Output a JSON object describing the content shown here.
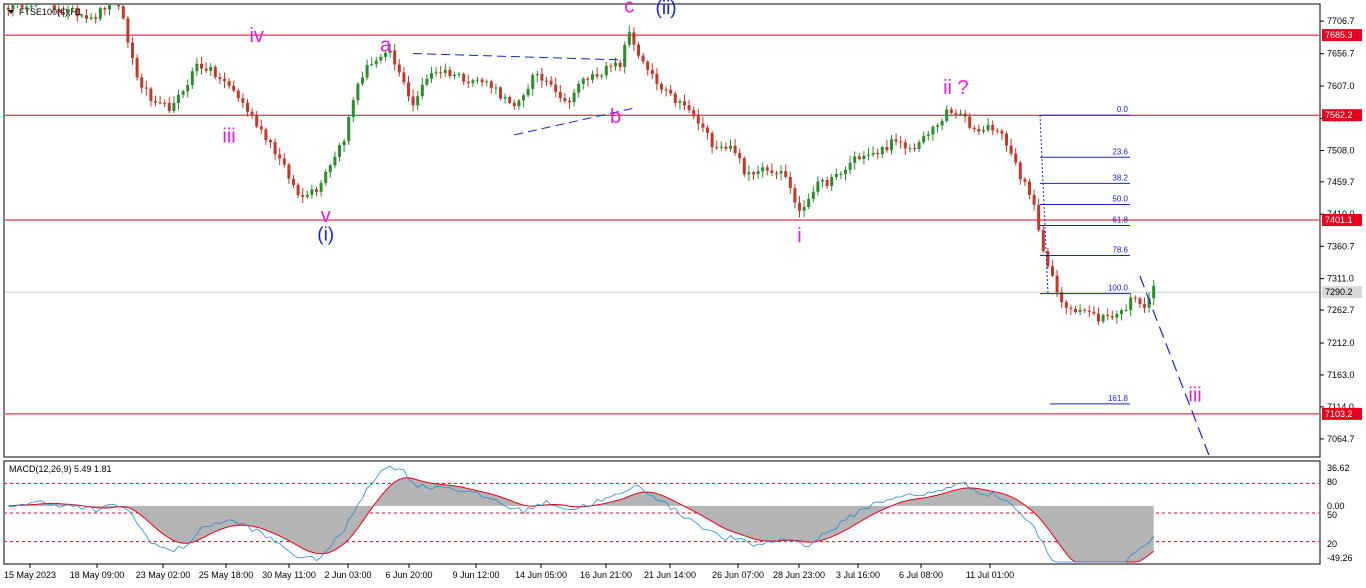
{
  "colors": {
    "bull": "#2e8b2e",
    "bear": "#c0392b",
    "hline": "#e8001c",
    "current_line": "#c8c8c8",
    "wave_major": "#1a23c8",
    "wave_minor": "#e020e0",
    "fib": "#1a23c8",
    "trend": "#1a23c8",
    "macd_hist": "#b4b4b4",
    "macd_signal": "#e8001c",
    "macd_line": "#2a8ad4"
  },
  "symbol_label": "FTSE100(€),H1",
  "chart_data": [
    {
      "type": "candlestick",
      "symbol": "FTSE100(€)",
      "timeframe": "H1",
      "ylim": [
        7040,
        7730
      ],
      "y_ticks": [
        "7706.7",
        "7656.7",
        "7607.0",
        "7557.0",
        "7508.0",
        "7459.7",
        "7410.0",
        "7360.7",
        "7311.0",
        "7262.7",
        "7212.0",
        "7163.0",
        "7114.0",
        "7064.7"
      ],
      "x_ticks": [
        "15 May 2023",
        "18 May 09:00",
        "23 May 02:00",
        "25 May 18:00",
        "30 May 11:00",
        "2 Jun 03:00",
        "6 Jun 20:00",
        "9 Jun 12:00",
        "14 Jun 05:00",
        "16 Jun 21:00",
        "21 Jun 14:00",
        "26 Jun 07:00",
        "28 Jun 23:00",
        "3 Jul 16:00",
        "6 Jul 08:00",
        "11 Jul 01:00"
      ],
      "horizontal_levels": [
        {
          "value": 7685.3,
          "label": "7685.3"
        },
        {
          "value": 7562.2,
          "label": "7562.2"
        },
        {
          "value": 7401.1,
          "label": "7401.1"
        },
        {
          "value": 7103.2,
          "label": "7103.2"
        }
      ],
      "current_price": {
        "value": 7290.2,
        "label": "7290.2"
      },
      "price_path_anchors": [
        [
          0,
          7730
        ],
        [
          6,
          7738
        ],
        [
          12,
          7722
        ],
        [
          19,
          7715
        ],
        [
          23,
          7742
        ],
        [
          25,
          7705
        ],
        [
          28,
          7620
        ],
        [
          32,
          7575
        ],
        [
          36,
          7575
        ],
        [
          41,
          7640
        ],
        [
          43,
          7635
        ],
        [
          49,
          7600
        ],
        [
          57,
          7520
        ],
        [
          63,
          7440
        ],
        [
          67,
          7450
        ],
        [
          73,
          7528
        ],
        [
          76,
          7612
        ],
        [
          79,
          7645
        ],
        [
          83,
          7655
        ],
        [
          86,
          7610
        ],
        [
          88,
          7580
        ],
        [
          92,
          7630
        ],
        [
          95,
          7630
        ],
        [
          99,
          7620
        ],
        [
          105,
          7610
        ],
        [
          110,
          7570
        ],
        [
          114,
          7620
        ],
        [
          118,
          7615
        ],
        [
          121,
          7580
        ],
        [
          125,
          7615
        ],
        [
          129,
          7630
        ],
        [
          133,
          7640
        ],
        [
          135,
          7690
        ],
        [
          138,
          7640
        ],
        [
          142,
          7600
        ],
        [
          148,
          7570
        ],
        [
          153,
          7520
        ],
        [
          158,
          7510
        ],
        [
          160,
          7470
        ],
        [
          164,
          7485
        ],
        [
          169,
          7470
        ],
        [
          172,
          7410
        ],
        [
          175,
          7450
        ],
        [
          181,
          7470
        ],
        [
          184,
          7498
        ],
        [
          188,
          7500
        ],
        [
          192,
          7520
        ],
        [
          196,
          7510
        ],
        [
          199,
          7525
        ],
        [
          204,
          7565
        ],
        [
          207,
          7562
        ],
        [
          210,
          7540
        ],
        [
          214,
          7545
        ],
        [
          217,
          7520
        ],
        [
          220,
          7470
        ],
        [
          223,
          7420
        ],
        [
          226,
          7330
        ],
        [
          229,
          7270
        ],
        [
          233,
          7265
        ],
        [
          237,
          7250
        ],
        [
          242,
          7260
        ],
        [
          245,
          7285
        ],
        [
          247,
          7270
        ],
        [
          249,
          7295
        ]
      ],
      "fibonacci": {
        "levels": [
          {
            "label": "0.0",
            "value": 7562.2
          },
          {
            "label": "23.6",
            "value": 7497.5
          },
          {
            "label": "38.2",
            "value": 7457.4
          },
          {
            "label": "50.0",
            "value": 7425.0
          },
          {
            "label": "61.8",
            "value": 7392.7
          },
          {
            "label": "78.6",
            "value": 7346.6
          },
          {
            "label": "100.0",
            "value": 7287.9
          },
          {
            "label": "161.8",
            "value": 7118.5
          }
        ]
      },
      "wave_labels": [
        {
          "text": "c",
          "level": "minor",
          "bar": 135,
          "value": 7720
        },
        {
          "text": "(ii)",
          "level": "major",
          "bar": 143,
          "value": 7718
        },
        {
          "text": "a",
          "level": "minor",
          "bar": 82,
          "value": 7660
        },
        {
          "text": "b",
          "level": "minor",
          "bar": 132,
          "value": 7550
        },
        {
          "text": "iv",
          "level": "minor",
          "bar": 54,
          "value": 7675
        },
        {
          "text": "iii",
          "level": "minor",
          "bar": 48,
          "value": 7520
        },
        {
          "text": "v",
          "level": "minor",
          "bar": 69,
          "value": 7398
        },
        {
          "text": "(i)",
          "level": "major",
          "bar": 69,
          "value": 7370
        },
        {
          "text": "i",
          "level": "minor",
          "bar": 172,
          "value": 7367
        },
        {
          "text": "ii ?",
          "level": "minor",
          "bar": 206,
          "value": 7595
        },
        {
          "text": "iii",
          "level": "minor",
          "bar": 258,
          "value": 7122
        }
      ],
      "trendlines": [
        {
          "from": [
            88,
            7657
          ],
          "to": [
            134,
            7647
          ]
        },
        {
          "from": [
            110,
            7532
          ],
          "to": [
            136,
            7573
          ]
        }
      ],
      "projection": {
        "from": [
          246,
          7315
        ],
        "to": [
          261,
          7040
        ]
      }
    },
    {
      "type": "macd",
      "label": "MACD(12,26,9) 5.49 1.81",
      "params": [
        12,
        26,
        9
      ],
      "macd_value": 5.49,
      "signal_value": 1.81,
      "ylim": [
        -55,
        42
      ],
      "y_ticks": [
        "36.62",
        "80",
        "0.00",
        "50",
        "20",
        "-49.26"
      ],
      "dotted_levels": [
        22,
        -7,
        -35
      ]
    }
  ]
}
